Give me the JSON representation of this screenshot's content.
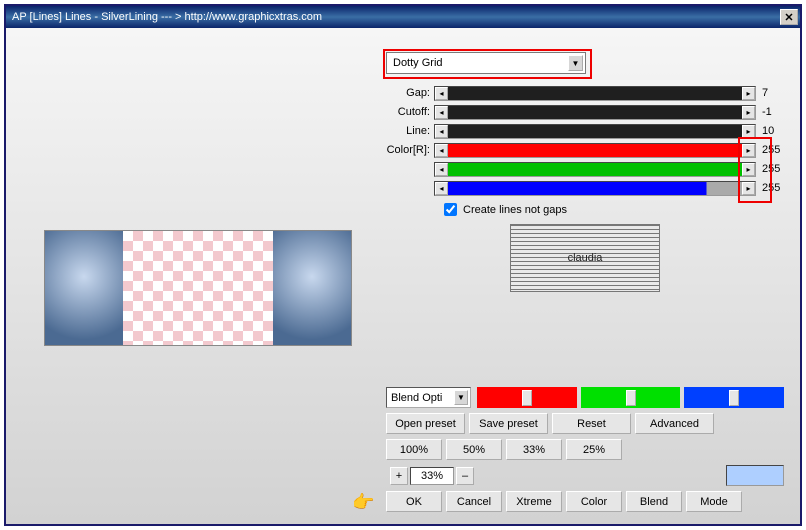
{
  "title": "AP [Lines]  Lines - SilverLining    --- >  http://www.graphicxtras.com",
  "preset": {
    "selected": "Dotty Grid"
  },
  "sliders": {
    "gap": {
      "label": "Gap:",
      "value": "7"
    },
    "cutoff": {
      "label": "Cutoff:",
      "value": "-1"
    },
    "line": {
      "label": "Line:",
      "value": "10"
    },
    "colorR": {
      "label": "Color[R]:",
      "value": "255"
    },
    "colorG": {
      "label": "",
      "value": "255"
    },
    "colorB": {
      "label": "",
      "value": "255"
    }
  },
  "checkbox": {
    "create_lines_not_gaps": "Create lines not gaps"
  },
  "logo_text": "claudia",
  "blend_opts": "Blend Opti",
  "row_presets": {
    "open": "Open preset",
    "save": "Save preset",
    "reset": "Reset",
    "advanced": "Advanced"
  },
  "zoom": {
    "p100": "100%",
    "p50": "50%",
    "p33": "33%",
    "p25": "25%",
    "spin": "33%",
    "plus": "+",
    "minus": "–"
  },
  "footer": {
    "ok": "OK",
    "cancel": "Cancel",
    "xtreme": "Xtreme",
    "color": "Color",
    "blend": "Blend",
    "mode": "Mode"
  }
}
